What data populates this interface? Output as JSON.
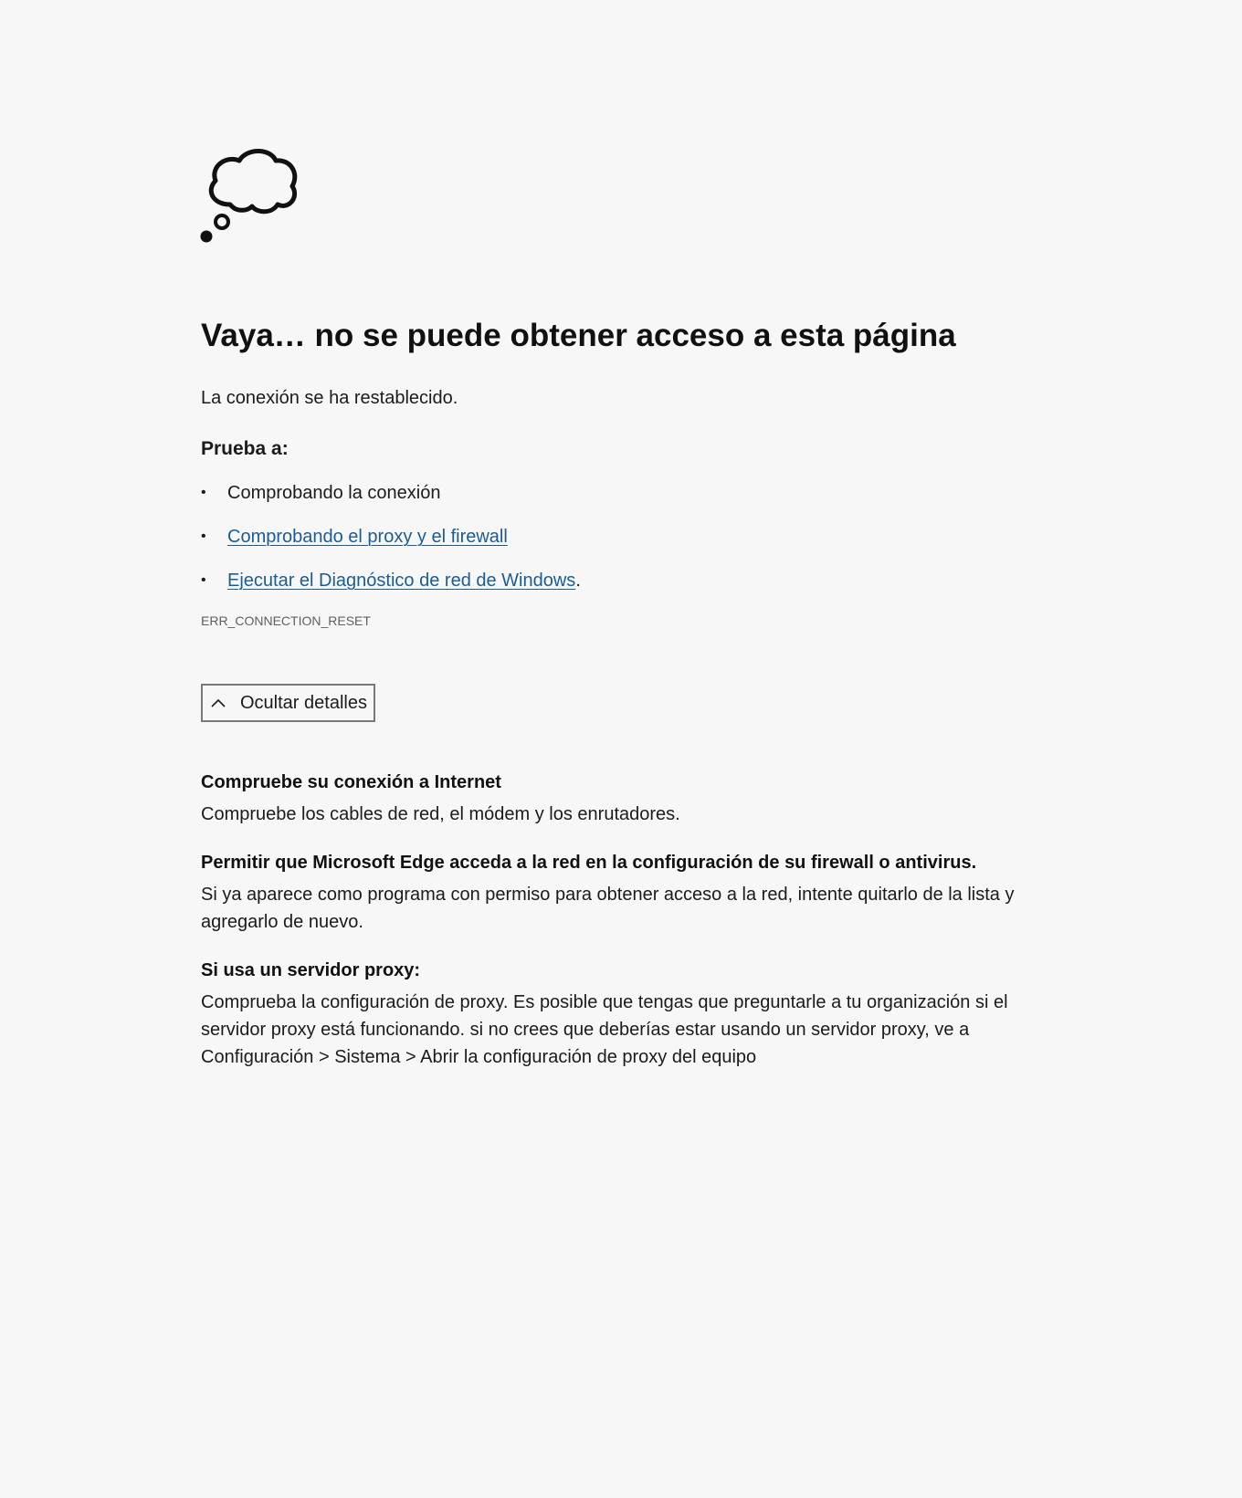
{
  "icon": "thought-cloud-icon",
  "title": "Vaya… no se puede obtener acceso a esta página",
  "message": "La conexión se ha restablecido.",
  "try_heading": "Prueba a:",
  "suggestions": [
    {
      "text": "Comprobando la conexión",
      "is_link": false,
      "suffix": ""
    },
    {
      "text": "Comprobando el proxy y el firewall",
      "is_link": true,
      "suffix": ""
    },
    {
      "text": "Ejecutar el Diagnóstico de red de Windows",
      "is_link": true,
      "suffix": "."
    }
  ],
  "error_code": "ERR_CONNECTION_RESET",
  "details_button": {
    "label": "Ocultar detalles",
    "icon": "chevron-up-icon"
  },
  "details": [
    {
      "title": "Compruebe su conexión a Internet",
      "text": "Compruebe los cables de red, el módem y los enrutadores."
    },
    {
      "title": "Permitir que Microsoft Edge acceda a la red en la configuración de su firewall o antivirus.",
      "text": "Si ya aparece como programa con permiso para obtener acceso a la red, intente quitarlo de la lista y agregarlo de nuevo."
    },
    {
      "title": "Si usa un servidor proxy:",
      "text": "Comprueba la configuración de proxy. Es posible que tengas que preguntarle a tu organización si el servidor proxy está funcionando. si no crees que deberías estar usando un servidor proxy, ve a Configuración > Sistema > Abrir la configuración de proxy del equipo"
    }
  ],
  "colors": {
    "background": "#f7f7f7",
    "link": "#1a5c99",
    "text": "#1b1b1b",
    "muted": "#5f5f5f",
    "button_border": "#7a7a7a"
  }
}
